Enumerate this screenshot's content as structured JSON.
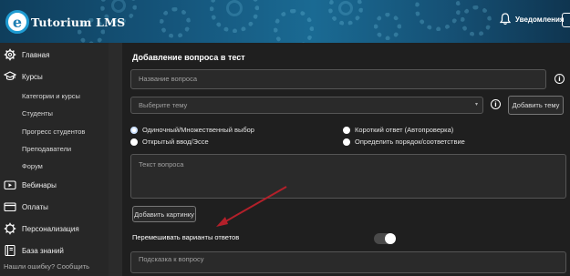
{
  "header": {
    "logo_letter": "e",
    "logo_text": "Tutorium LMS",
    "notifications_label": "Уведомления"
  },
  "sidebar": {
    "items": [
      {
        "label": "Главная",
        "icon": "gear-icon"
      },
      {
        "label": "Курсы",
        "icon": "graduation-cap-icon"
      },
      {
        "label": "Категории и курсы"
      },
      {
        "label": "Студенты"
      },
      {
        "label": "Прогресс студентов"
      },
      {
        "label": "Преподаватели"
      },
      {
        "label": "Форум"
      },
      {
        "label": "Вебинары",
        "icon": "video-play-icon"
      },
      {
        "label": "Оплаты",
        "icon": "credit-card-icon"
      },
      {
        "label": "Персонализация",
        "icon": "gear-icon"
      },
      {
        "label": "База знаний",
        "icon": "book-icon"
      }
    ],
    "footer_link": "Нашли ошибку? Сообщить"
  },
  "main": {
    "title": "Добавление вопроса в тест",
    "question_name_placeholder": "Название вопроса",
    "topic_select_placeholder": "Выберите тему",
    "add_topic_button": "Добавить тему",
    "question_types": [
      {
        "label": "Одиночный/Множественный выбор",
        "checked": true
      },
      {
        "label": "Открытый ввод/Эссе",
        "checked": false
      },
      {
        "label": "Короткий ответ (Автопроверка)",
        "checked": false
      },
      {
        "label": "Определить порядок/соответствие",
        "checked": false
      }
    ],
    "question_text_placeholder": "Текст вопроса",
    "add_image_button": "Добавить картинку",
    "shuffle_label": "Перемешивать варианты ответов",
    "shuffle_enabled": true,
    "hint_placeholder": "Подсказка к вопросу"
  },
  "colors": {
    "accent": "#1f9bd1",
    "arrow": "#b3202a",
    "header_bg": "#15557b"
  }
}
